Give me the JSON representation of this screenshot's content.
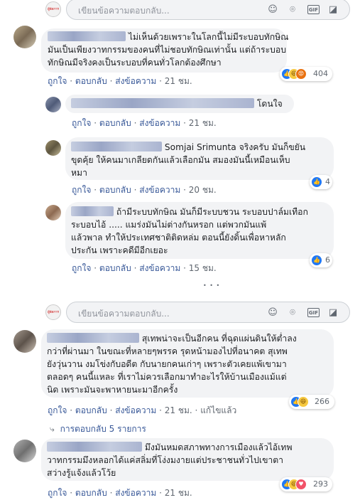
{
  "reply_placeholder": "เขียนข้อความตอบกลับ...",
  "avatar_badge": "ผู้จัดการ",
  "actions": {
    "like": "ถูกใจ",
    "reply": "ตอบกลับ",
    "send": "ส่งข้อความ",
    "sep": "·"
  },
  "more_dots": "• • •",
  "comments": [
    {
      "lines": [
        "ไม่เห็นด้วยเพราะในโลกนี้ไม่มีระบอบทักษิณ",
        "มันเป็นเพียงวาทกรรมของคนที่ไม่ชอบทักษิณเท่านั้น แต่ถ้าระบอบ",
        "ทักษิณมีจริงคงเป็นระบอบที่คนทั่วโลกต้องศึกษา"
      ],
      "time": "21 ชม.",
      "reaction_count": "404"
    },
    {
      "lines": [
        "โดนใจ"
      ],
      "time": "21 ชม."
    },
    {
      "lines": [
        "Somjai Srimunta จริงครับ มันก็ขยัน",
        "ขุดคุ้ย ให้คนมาเกลียดกันแล้วเลือกมัน สมองมันนี้เหมือนเห็บ",
        "หมา"
      ],
      "time": "20 ชม.",
      "reaction_count": "4"
    },
    {
      "lines": [
        "ถ้ามีระบบทักษิณ มันก็มีระบบชวน ระบอบปาล์มเทือก",
        "ระบอบไอ้ ..... แมร่งมันไม่ต่างกันหรอก แต่พวกมันแพ้",
        "แล้วพาล ทำให้ประเทศชาติติดหล่ม ตอนนี้ยังดิ้นเพื่อหาหลัก",
        "ประกัน เพราะคดีมีอีกเยอะ"
      ],
      "time": "15 ชม.",
      "reaction_count": "6"
    },
    {
      "lines": [
        "สุเทพน่าจะเป็นอีกคน ที่ฉุดแผ่นดินให้ต่ำลง",
        "กว่าที่ผ่านมา ในขณะที่หลายๆพรรค รุดหน้ามองไปที่อนาคต สุเทพ",
        "ยังวุ่นวาน งมโข่งกับอดีต กับนายกคนเก่าๆ เพราะตัวเคยแพ้เขามา",
        "ตลอดๆ คนนี้แหละ ที่เราไม่ควรเลือกมาทำอะไรให้บ้านเมืองแม้แต่",
        "นิด เพราะมันจะพาหายนะมาอีกครั้ง"
      ],
      "time": "21 ชม.",
      "edited": "แก้ไขแล้ว",
      "reaction_count": "266",
      "replies_link": "การตอบกลับ 5 รายการ"
    },
    {
      "lines": [
        "มึงมันหมดสภาพทางการเมืองแล้วไอ้เทพ",
        "วาทกรรมมึงหลอกได้แค่สลิ่มที่โง่งมงายแต่ประชาชนทั่วไปเขาตา",
        "สว่างรู้แจ้งแล้วโว้ย"
      ],
      "time": "21 ชม.",
      "reaction_count": "293"
    }
  ]
}
